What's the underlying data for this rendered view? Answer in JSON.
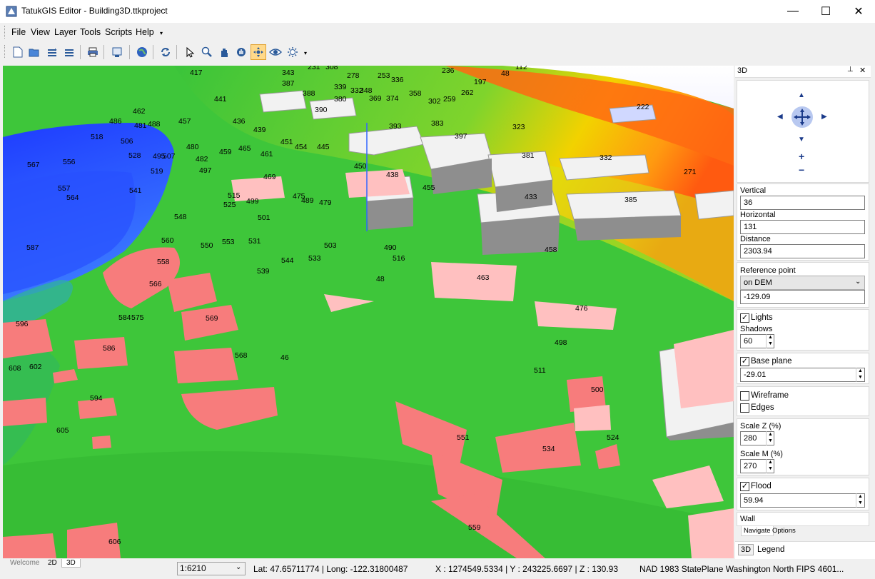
{
  "window": {
    "title": "TatukGIS Editor - Building3D.ttkproject",
    "minimize": "—",
    "maximize": "☐",
    "close": "✕"
  },
  "menu": [
    {
      "label": "File"
    },
    {
      "label": "View"
    },
    {
      "label": "Layer"
    },
    {
      "label": "Tools"
    },
    {
      "label": "Scripts"
    },
    {
      "label": "Help"
    }
  ],
  "toolbar": {
    "icons": [
      "new-project-icon",
      "open-project-icon",
      "add-layer-icon",
      "remove-layer-icon",
      "print-icon",
      "export-icon",
      "globe-icon",
      "refresh-icon",
      "select-icon",
      "zoom-icon",
      "pan-icon",
      "hand-3d-icon",
      "navigate-3d-icon",
      "eye-icon",
      "light-icon"
    ]
  },
  "map": {
    "labels": [
      {
        "t": "417"
      },
      {
        "t": "343"
      },
      {
        "t": "231"
      },
      {
        "t": "308"
      },
      {
        "t": "278"
      },
      {
        "t": "253"
      },
      {
        "t": "236"
      },
      {
        "t": "112"
      },
      {
        "t": "48"
      },
      {
        "t": "387"
      },
      {
        "t": "336"
      },
      {
        "t": "197"
      },
      {
        "t": "441"
      },
      {
        "t": "388"
      },
      {
        "t": "339"
      },
      {
        "t": "332"
      },
      {
        "t": "348"
      },
      {
        "t": "369"
      },
      {
        "t": "374"
      },
      {
        "t": "358"
      },
      {
        "t": "302"
      },
      {
        "t": "259"
      },
      {
        "t": "262"
      },
      {
        "t": "380"
      },
      {
        "t": "390"
      },
      {
        "t": "222"
      },
      {
        "t": "462"
      },
      {
        "t": "457"
      },
      {
        "t": "436"
      },
      {
        "t": "486"
      },
      {
        "t": "481"
      },
      {
        "t": "488"
      },
      {
        "t": "439"
      },
      {
        "t": "393"
      },
      {
        "t": "383"
      },
      {
        "t": "323"
      },
      {
        "t": "518"
      },
      {
        "t": "506"
      },
      {
        "t": "480"
      },
      {
        "t": "465"
      },
      {
        "t": "451"
      },
      {
        "t": "454"
      },
      {
        "t": "445"
      },
      {
        "t": "397"
      },
      {
        "t": "381"
      },
      {
        "t": "332"
      },
      {
        "t": "567"
      },
      {
        "t": "556"
      },
      {
        "t": "528"
      },
      {
        "t": "495"
      },
      {
        "t": "507"
      },
      {
        "t": "482"
      },
      {
        "t": "459"
      },
      {
        "t": "461"
      },
      {
        "t": "450"
      },
      {
        "t": "438"
      },
      {
        "t": "271"
      },
      {
        "t": "519"
      },
      {
        "t": "497"
      },
      {
        "t": "469"
      },
      {
        "t": "557"
      },
      {
        "t": "541"
      },
      {
        "t": "455"
      },
      {
        "t": "433"
      },
      {
        "t": "385"
      },
      {
        "t": "564"
      },
      {
        "t": "515"
      },
      {
        "t": "475"
      },
      {
        "t": "489"
      },
      {
        "t": "479"
      },
      {
        "t": "525"
      },
      {
        "t": "499"
      },
      {
        "t": "548"
      },
      {
        "t": "501"
      },
      {
        "t": "560"
      },
      {
        "t": "550"
      },
      {
        "t": "553"
      },
      {
        "t": "531"
      },
      {
        "t": "503"
      },
      {
        "t": "490"
      },
      {
        "t": "587"
      },
      {
        "t": "558"
      },
      {
        "t": "544"
      },
      {
        "t": "533"
      },
      {
        "t": "516"
      },
      {
        "t": "458"
      },
      {
        "t": "539"
      },
      {
        "t": "463"
      },
      {
        "t": "566"
      },
      {
        "t": "48"
      },
      {
        "t": "476"
      },
      {
        "t": "584"
      },
      {
        "t": "575"
      },
      {
        "t": "569"
      },
      {
        "t": "596"
      },
      {
        "t": "498"
      },
      {
        "t": "586"
      },
      {
        "t": "568"
      },
      {
        "t": "46"
      },
      {
        "t": "511"
      },
      {
        "t": "608"
      },
      {
        "t": "602"
      },
      {
        "t": "500"
      },
      {
        "t": "594"
      },
      {
        "t": "605"
      },
      {
        "t": "551"
      },
      {
        "t": "524"
      },
      {
        "t": "534"
      },
      {
        "t": "559"
      },
      {
        "t": "606"
      }
    ]
  },
  "panel": {
    "title": "3D",
    "pin": "📌",
    "close": "✕",
    "vertical_label": "Vertical",
    "vertical_value": "36",
    "horizontal_label": "Horizontal",
    "horizontal_value": "131",
    "distance_label": "Distance",
    "distance_value": "2303.94",
    "reference_label": "Reference point",
    "reference_select": "on DEM",
    "reference_value": "-129.09",
    "lights_label": "Lights",
    "shadows_label": "Shadows",
    "shadows_value": "60",
    "baseplane_label": "Base plane",
    "baseplane_value": "-29.01",
    "wireframe_label": "Wireframe",
    "edges_label": "Edges",
    "scalez_label": "Scale Z (%)",
    "scalez_value": "280",
    "scalem_label": "Scale M (%)",
    "scalem_value": "270",
    "flood_label": "Flood",
    "flood_value": "59.94",
    "wall_label": "Wall",
    "tab_navigate": "Navigate",
    "tab_options": "Options",
    "bottom_tab_3d": "3D",
    "bottom_tab_legend": "Legend",
    "zoom_in": "+",
    "zoom_out": "−"
  },
  "bottom_tabs": [
    "Welcome",
    "2D",
    "3D"
  ],
  "status": {
    "scale": "1:6210",
    "latlong": "Lat: 47.65711774 | Long: -122.31800487",
    "xyz": "X : 1274549.5334 | Y : 243225.6697 | Z : 130.93",
    "crs": "NAD 1983 StatePlane Washington North FIPS 4601..."
  },
  "colors": {
    "accent": "#3399ff",
    "terrain_low": "#2233ff",
    "terrain_mid": "#3ec63a",
    "terrain_high": "#ff5a10"
  }
}
